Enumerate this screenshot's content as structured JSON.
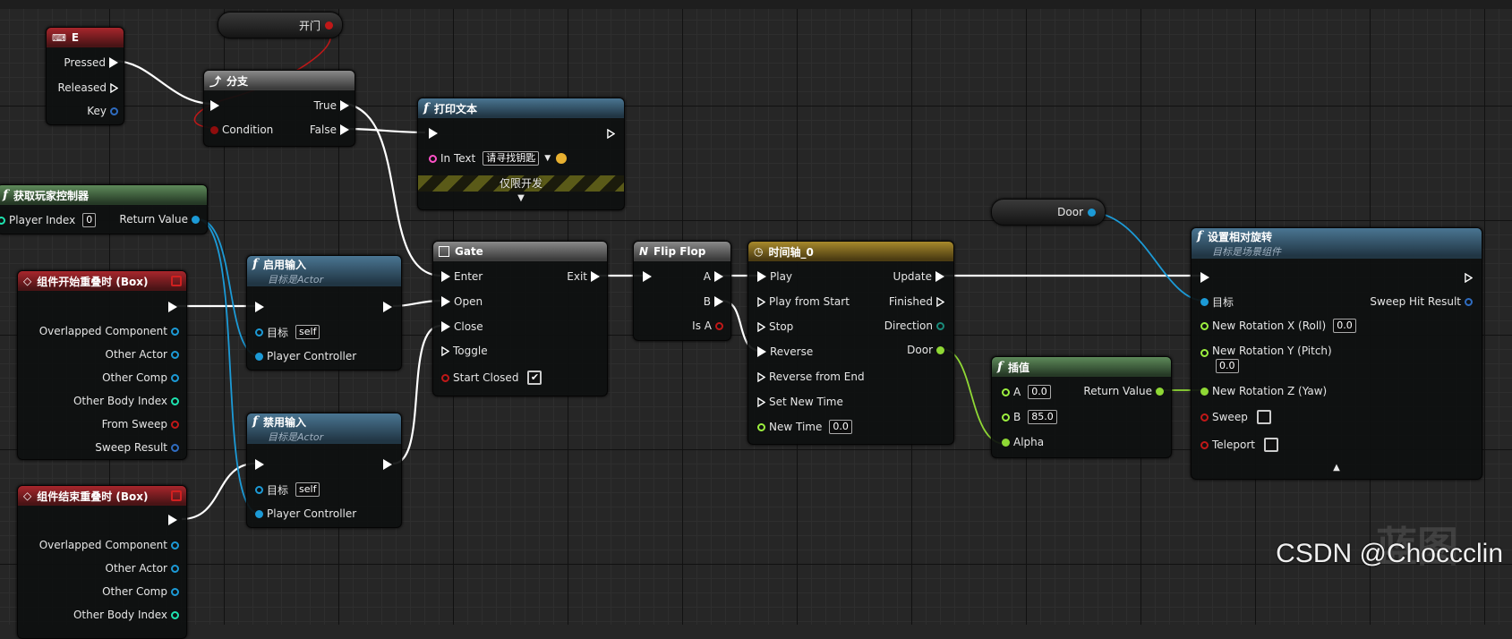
{
  "nodes": {
    "e_key": {
      "title": "E",
      "pins": {
        "pressed": "Pressed",
        "released": "Released",
        "key": "Key"
      }
    },
    "open_door_var": {
      "label": "开门"
    },
    "branch": {
      "title": "分支",
      "pins": {
        "condition": "Condition",
        "true": "True",
        "false": "False"
      }
    },
    "print_string": {
      "title": "打印文本",
      "in_text_label": "In Text",
      "in_text_value": "请寻找钥匙",
      "dev_only": "仅限开发"
    },
    "get_player_controller": {
      "title": "获取玩家控制器",
      "player_index_label": "Player Index",
      "player_index_value": "0",
      "return_value": "Return Value"
    },
    "begin_overlap": {
      "title": "组件开始重叠时 (Box)",
      "pins": [
        "Overlapped Component",
        "Other Actor",
        "Other Comp",
        "Other Body Index",
        "From Sweep",
        "Sweep Result"
      ]
    },
    "enable_input": {
      "title": "启用输入",
      "subtitle": "目标是Actor",
      "target_label": "目标",
      "target_value": "self",
      "player_controller": "Player Controller"
    },
    "disable_input": {
      "title": "禁用输入",
      "subtitle": "目标是Actor",
      "target_label": "目标",
      "target_value": "self",
      "player_controller": "Player Controller"
    },
    "end_overlap": {
      "title": "组件结束重叠时 (Box)",
      "pins": [
        "Overlapped Component",
        "Other Actor",
        "Other Comp",
        "Other Body Index"
      ]
    },
    "gate": {
      "title": "Gate",
      "pins": {
        "enter": "Enter",
        "exit": "Exit",
        "open": "Open",
        "close": "Close",
        "toggle": "Toggle",
        "start_closed": "Start Closed"
      },
      "start_closed_checked": true
    },
    "flip_flop": {
      "title": "Flip Flop",
      "pins": {
        "a": "A",
        "b": "B",
        "is_a": "Is A"
      }
    },
    "timeline": {
      "title": "时间轴_0",
      "inputs": [
        "Play",
        "Play from Start",
        "Stop",
        "Reverse",
        "Reverse from End",
        "Set New Time"
      ],
      "new_time_label": "New Time",
      "new_time_value": "0.0",
      "outputs": {
        "update": "Update",
        "finished": "Finished",
        "direction": "Direction",
        "door": "Door"
      }
    },
    "door_var": {
      "label": "Door"
    },
    "lerp": {
      "title": "插值",
      "a_label": "A",
      "a_value": "0.0",
      "b_label": "B",
      "b_value": "85.0",
      "alpha": "Alpha",
      "return_value": "Return Value"
    },
    "set_relative_rotation": {
      "title": "设置相对旋转",
      "subtitle": "目标是场景组件",
      "target_label": "目标",
      "sweep_hit_result": "Sweep Hit Result",
      "rot_x_label": "New Rotation X (Roll)",
      "rot_x_value": "0.0",
      "rot_y_label": "New Rotation Y (Pitch)",
      "rot_y_value": "0.0",
      "rot_z_label": "New Rotation Z (Yaw)",
      "sweep": "Sweep",
      "teleport": "Teleport"
    }
  },
  "watermark": "CSDN @Choccclin",
  "watermark_ghost": "蓝图",
  "colors": {
    "exec": "#ffffff",
    "bool": "#8f0d0d",
    "object": "#00a7f0",
    "float": "#9cef3f",
    "int": "#1ee3b0",
    "string": "#ff52c8",
    "struct": "#2f6cc0"
  }
}
